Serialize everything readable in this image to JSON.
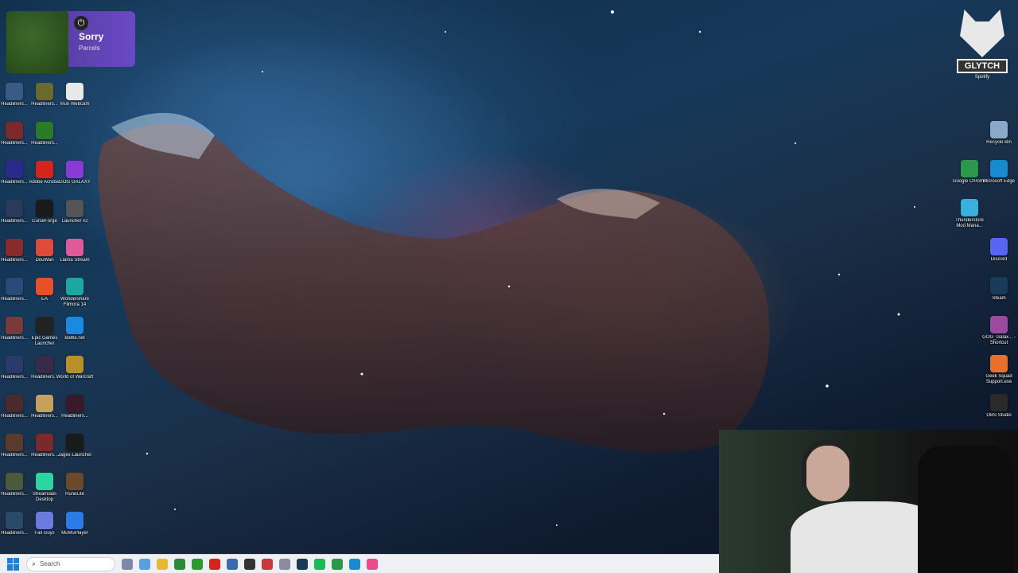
{
  "notification": {
    "title": "Sorry",
    "subtitle": "Parcels"
  },
  "left_icons": [
    {
      "label": "Headliners...",
      "col": 0,
      "row": 0,
      "color": "#3a5a88"
    },
    {
      "label": "Headliners...",
      "col": 1,
      "row": 0,
      "color": "#6a6a2a"
    },
    {
      "label": "Inun Webcam",
      "col": 2,
      "row": 0,
      "color": "#e8e8e8",
      "icon": "webcam-icon"
    },
    {
      "label": "Headliners...",
      "col": 0,
      "row": 1,
      "color": "#7a2a2a"
    },
    {
      "label": "Headliners...",
      "col": 1,
      "row": 1,
      "color": "#2a7a2a"
    },
    {
      "label": "Headliners...",
      "col": 0,
      "row": 2,
      "color": "#2a2a8a"
    },
    {
      "label": "Adobe Acrobat",
      "col": 1,
      "row": 2,
      "color": "#d6241c",
      "icon": "acrobat-icon"
    },
    {
      "label": "GOG GALAXY",
      "col": 2,
      "row": 2,
      "color": "#8a3ad6",
      "icon": "gog-icon"
    },
    {
      "label": "Headliners...",
      "col": 0,
      "row": 3,
      "color": "#2a3a5a"
    },
    {
      "label": "CurseForge",
      "col": 1,
      "row": 3,
      "color": "#1a1a1a",
      "icon": "curseforge-icon"
    },
    {
      "label": "Launcher v2",
      "col": 2,
      "row": 3,
      "color": "#555555",
      "icon": "launcher-icon"
    },
    {
      "label": "Headliners...",
      "col": 0,
      "row": 4,
      "color": "#8a2a2a"
    },
    {
      "label": "DouWan",
      "col": 1,
      "row": 4,
      "color": "#e04a3a",
      "icon": "douwan-icon"
    },
    {
      "label": "Llama Stream",
      "col": 2,
      "row": 4,
      "color": "#e05a9a",
      "icon": "location-icon"
    },
    {
      "label": "Headliners...",
      "col": 0,
      "row": 5,
      "color": "#2a4a7a"
    },
    {
      "label": "EA",
      "col": 1,
      "row": 5,
      "color": "#e8502a",
      "icon": "ea-icon"
    },
    {
      "label": "Wondershare Filmora 14",
      "col": 2,
      "row": 5,
      "color": "#1aa8a0",
      "icon": "filmora-icon"
    },
    {
      "label": "Headliners...",
      "col": 0,
      "row": 6,
      "color": "#7a3a3a"
    },
    {
      "label": "Epic Games Launcher",
      "col": 1,
      "row": 6,
      "color": "#222222",
      "icon": "epic-icon"
    },
    {
      "label": "Battle.net",
      "col": 2,
      "row": 6,
      "color": "#1a8ae0",
      "icon": "battlenet-icon"
    },
    {
      "label": "Headliners...",
      "col": 0,
      "row": 7,
      "color": "#2a3a6a"
    },
    {
      "label": "Headliners...",
      "col": 1,
      "row": 7,
      "color": "#3a2a4a"
    },
    {
      "label": "World of Warcraft",
      "col": 2,
      "row": 7,
      "color": "#b8902a",
      "icon": "wow-icon"
    },
    {
      "label": "Headliners...",
      "col": 0,
      "row": 8,
      "color": "#4a2a2a"
    },
    {
      "label": "Headliners...",
      "col": 1,
      "row": 8,
      "color": "#c8a05a"
    },
    {
      "label": "Headliners...",
      "col": 2,
      "row": 8,
      "color": "#3a1a2a"
    },
    {
      "label": "Headliners...",
      "col": 0,
      "row": 9,
      "color": "#5a3a2a"
    },
    {
      "label": "Headliners...",
      "col": 1,
      "row": 9,
      "color": "#7a2a2a"
    },
    {
      "label": "Jagex Launcher",
      "col": 2,
      "row": 9,
      "color": "#1a1a1a",
      "icon": "jagex-icon"
    },
    {
      "label": "Headliners...",
      "col": 0,
      "row": 10,
      "color": "#4a5a3a"
    },
    {
      "label": "Streamlabs Desktop",
      "col": 1,
      "row": 10,
      "color": "#2ad6a0",
      "icon": "streamlabs-icon"
    },
    {
      "label": "RuneLite",
      "col": 2,
      "row": 10,
      "color": "#6a4a2a",
      "icon": "runelite-icon"
    },
    {
      "label": "Headliners...",
      "col": 0,
      "row": 11,
      "color": "#2a4a6a"
    },
    {
      "label": "Fall Guys",
      "col": 1,
      "row": 11,
      "color": "#6a7ae0",
      "icon": "fallguys-icon"
    },
    {
      "label": "MuMuPlayer",
      "col": 2,
      "row": 11,
      "color": "#2a7ae8",
      "icon": "mumu-icon"
    }
  ],
  "right_icons": [
    {
      "label": "Recycle Bin",
      "col": 1,
      "row": 0,
      "color": "#8aa8c8",
      "icon": "recycle-bin-icon"
    },
    {
      "label": "Google Chrome",
      "col": 0,
      "row": 1,
      "color": "#2a9a4a",
      "icon": "chrome-icon"
    },
    {
      "label": "Microsoft Edge",
      "col": 1,
      "row": 1,
      "color": "#1a8ad0",
      "icon": "edge-icon"
    },
    {
      "label": "Thunderstore Mod Mana...",
      "col": 0,
      "row": 2,
      "color": "#3ab0e0",
      "icon": "thunderstore-icon"
    },
    {
      "label": "Discord",
      "col": 1,
      "row": 3,
      "color": "#5865f2",
      "icon": "discord-icon"
    },
    {
      "label": "Steam",
      "col": 1,
      "row": 4,
      "color": "#1a3a5a",
      "icon": "steam-icon"
    },
    {
      "label": "GOG_Galax... - Shortcut",
      "col": 1,
      "row": 5,
      "color": "#9a4aa0",
      "icon": "gog-shortcut-icon"
    },
    {
      "label": "Geek Squad Support.exe",
      "col": 1,
      "row": 6,
      "color": "#e8702a",
      "icon": "geeksquad-icon"
    },
    {
      "label": "OBS Studio",
      "col": 1,
      "row": 7,
      "color": "#2a2a2a",
      "icon": "obs-icon"
    },
    {
      "label": "",
      "col": 1,
      "row": 8,
      "color": "#6a6aa0",
      "icon": "grid-icon"
    }
  ],
  "spotify_label": "Spotify",
  "glytch_text": "GLYTCH",
  "taskbar": {
    "search_placeholder": "Search",
    "apps": [
      {
        "name": "widgets-icon",
        "color": "#7a8aa8"
      },
      {
        "name": "copilot-icon",
        "color": "#5aa0e0"
      },
      {
        "name": "file-explorer-icon",
        "color": "#e8b830"
      },
      {
        "name": "spreadsheet-icon",
        "color": "#2a8a3a"
      },
      {
        "name": "xbox-icon",
        "color": "#2a9a2a"
      },
      {
        "name": "acrobat-taskbar-icon",
        "color": "#d6241c"
      },
      {
        "name": "calculator-icon",
        "color": "#3a6ab0"
      },
      {
        "name": "media-icon",
        "color": "#333333"
      },
      {
        "name": "app-icon",
        "color": "#c83a3a"
      },
      {
        "name": "settings-icon",
        "color": "#8a8aa0"
      },
      {
        "name": "steam-taskbar-icon",
        "color": "#1a3a5a"
      },
      {
        "name": "spotify-taskbar-icon",
        "color": "#1db954"
      },
      {
        "name": "chrome-taskbar-icon",
        "color": "#2a9a4a"
      },
      {
        "name": "edge-taskbar-icon",
        "color": "#1a8ad0"
      },
      {
        "name": "streaming-app-icon",
        "color": "#e84a8a"
      }
    ]
  }
}
